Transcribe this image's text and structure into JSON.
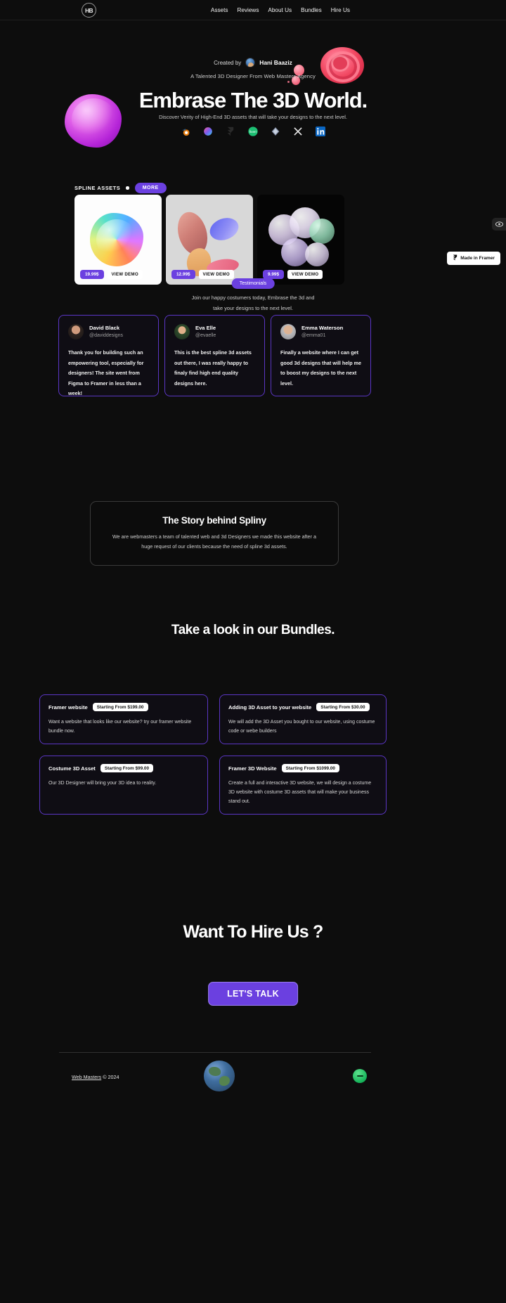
{
  "brand": {
    "logo_text": "HB",
    "accent": "#6b40e0",
    "background": "#0d0d0d"
  },
  "nav": {
    "items": [
      {
        "label": "Assets"
      },
      {
        "label": "Reviews"
      },
      {
        "label": "About Us"
      },
      {
        "label": "Bundles"
      },
      {
        "label": "Hire Us"
      }
    ]
  },
  "hero": {
    "created_by_label": "Created by",
    "author_name": "Hani Baaziz",
    "tagline": "A Talented 3D Designer From Web Masters Agency",
    "headline": "Embrase The 3D World.",
    "subline": "Discover Verity of High-End 3D assets that will take your designs to the next level.",
    "brand_icons": [
      "blender-icon",
      "spline-icon",
      "framer-icon",
      "fiverr-icon",
      "figma-icon",
      "x-twitter-icon",
      "linkedin-icon"
    ]
  },
  "assets": {
    "section_label": "SPLINE ASSETS",
    "more_label": "MORE",
    "cards": [
      {
        "price": "19.99$",
        "demo_label": "VIEW DEMO",
        "art": "iridescent-crystal"
      },
      {
        "price": "12.99$",
        "demo_label": "VIEW DEMO",
        "art": "organic-blobs"
      },
      {
        "price": "9.99$",
        "demo_label": "VIEW DEMO",
        "art": "glass-spheres"
      }
    ]
  },
  "floating": {
    "side_widget_icon": "eye-icon",
    "framer_badge_label": "Made in Framer",
    "framer_badge_icon": "framer-icon"
  },
  "testimonials": {
    "pill_label": "Testimonials",
    "subtitle_line1": "Join our happy costumers today, Embrase the 3d and",
    "subtitle_line2": "take your designs to the next level.",
    "cards": [
      {
        "name": "David Black",
        "handle": "@daviddesigns",
        "quote": "Thank you for building such an empowering tool, especially for designers! The site went from Figma to Framer in less than a week!"
      },
      {
        "name": "Eva Elle",
        "handle": "@evaelle",
        "quote": "This is the best spline 3d assets out there, I was really happy to finaly find high end quality designs here."
      },
      {
        "name": "Emma Waterson",
        "handle": "@emma01",
        "quote": "Finally a website where I can get good 3d designs that will help me to boost my designs to the next level."
      }
    ]
  },
  "story": {
    "title": "The Story behind Spliny",
    "body": "We are webmasters a team of talented web and 3d Designers we made this website after a huge request of our clients because the need of spline 3d assets."
  },
  "bundles": {
    "title": "Take a look in our Bundles.",
    "items": [
      {
        "name": "Framer website",
        "price": "Starting From $199.00",
        "desc": "Want a website that looks like our website? try our framer website bundle now."
      },
      {
        "name": "Adding 3D Asset to your website",
        "price": "Starting From $30.00",
        "desc": "We will add the 3D Asset you bought to our website, using costume code or webe builders"
      },
      {
        "name": "Costume 3D Asset",
        "price": "Starting From $99.00",
        "desc": "Our 3D Designer will bring your 3D idea to reality."
      },
      {
        "name": "Framer 3D Website",
        "price": "Starting From $1099.00",
        "desc": "Create a full and interactive 3D website, we will design a costume 3D website with costume 3D assets that will make your business stand out."
      }
    ]
  },
  "hire": {
    "title": "Want To Hire Us ?",
    "cta_label": "LET'S TALK"
  },
  "footer": {
    "link_text": "Web Masters",
    "copyright": " © 2024",
    "globe_icon": "globe-icon",
    "right_icon": "fiverr-icon"
  }
}
